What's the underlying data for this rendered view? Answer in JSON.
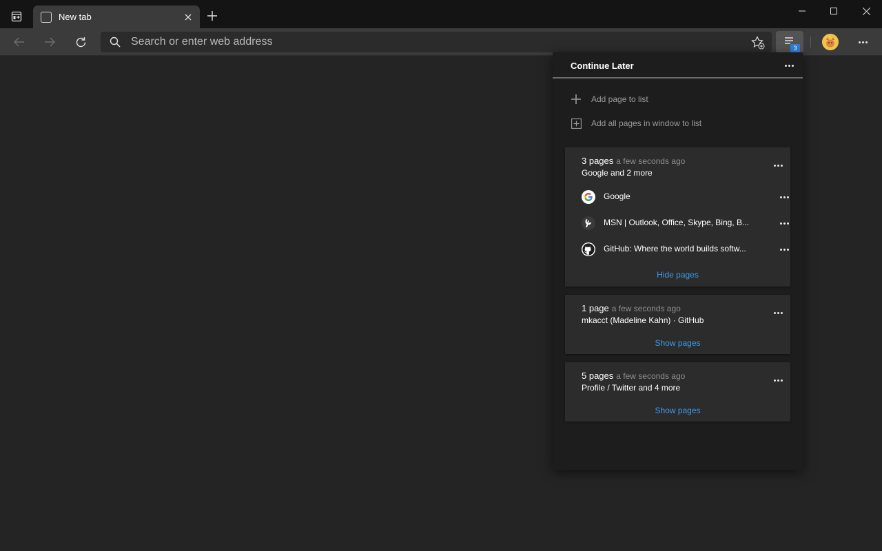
{
  "tab": {
    "title": "New tab"
  },
  "addressbar": {
    "placeholder": "Search or enter web address"
  },
  "collections_button": {
    "badge": "3"
  },
  "panel": {
    "title": "Continue Later",
    "actions": [
      {
        "label": "Add page to list",
        "icon": "plus-icon"
      },
      {
        "label": "Add all pages in window to list",
        "icon": "add-all-icon"
      }
    ],
    "groups": [
      {
        "count": "3 pages",
        "time": "a few seconds ago",
        "summary": "Google and 2 more",
        "pages": [
          {
            "title": "Google",
            "icon": "google-icon"
          },
          {
            "title": "MSN | Outlook, Office, Skype, Bing, B...",
            "icon": "msn-icon"
          },
          {
            "title": "GitHub: Where the world builds softw...",
            "icon": "github-icon"
          }
        ],
        "toggle": "Hide pages"
      },
      {
        "count": "1 page",
        "time": "a few seconds ago",
        "summary": "mkacct (Madeline Kahn) · GitHub",
        "toggle": "Show pages"
      },
      {
        "count": "5 pages",
        "time": "a few seconds ago",
        "summary": "Profile / Twitter and 4 more",
        "toggle": "Show pages"
      }
    ]
  },
  "colors": {
    "accent": "#3d9cf0",
    "badge": "#2f7fde",
    "panel_bg": "#1d1d1d",
    "card_bg": "#2c2c2c"
  }
}
